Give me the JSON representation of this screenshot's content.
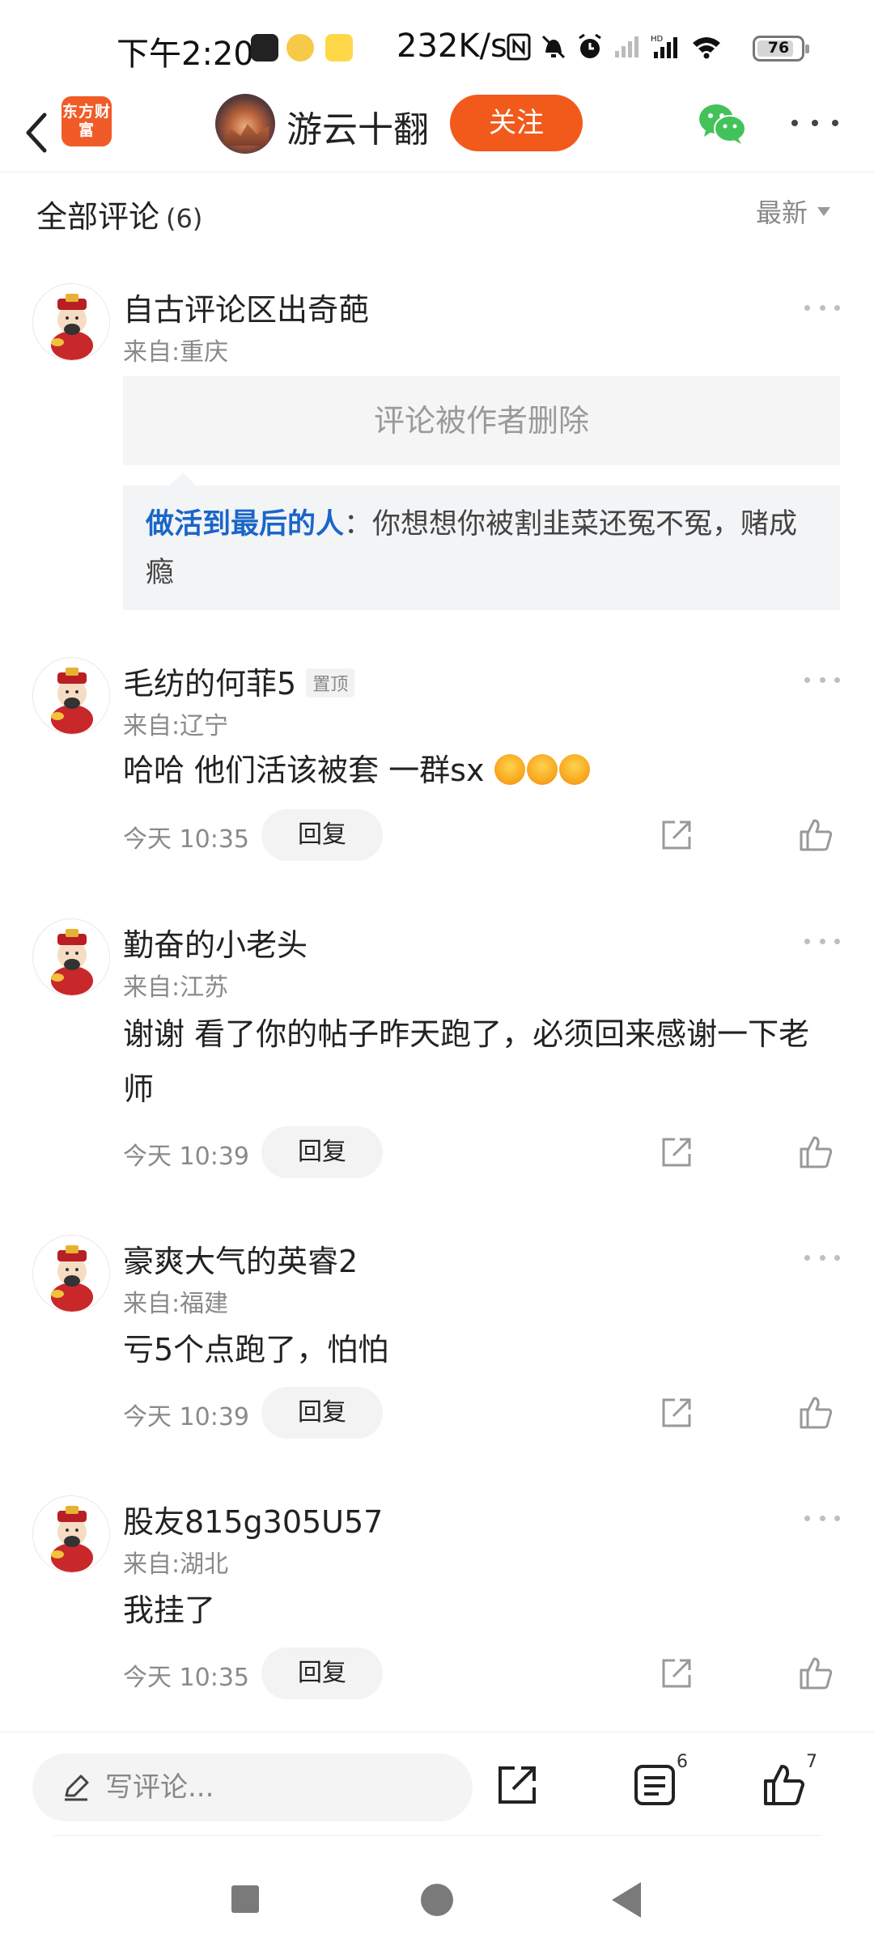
{
  "status_bar": {
    "time": "下午2:20",
    "net_speed": "232K/s",
    "battery": "76",
    "battery_level": 0.76
  },
  "header": {
    "back_icon": "chevron-left-icon",
    "brand_logo_text": "东方财富",
    "author_name": "游云十翻",
    "follow_label": "关注",
    "wechat_icon": "wechat-icon",
    "more_icon": "more-horizontal-icon"
  },
  "comments_header": {
    "title": "全部评论",
    "count": "(6)",
    "sort_label": "最新"
  },
  "comments": [
    {
      "nickname": "自古评论区出奇葩",
      "location": "来自:重庆",
      "deleted_text": "评论被作者删除",
      "quote_author": "做活到最后的人",
      "quote_text": "：你想想你被割韭菜还冤不冤，赌成瘾"
    },
    {
      "nickname": "毛纺的何菲5",
      "pin_tag": "置顶",
      "location": "来自:辽宁",
      "text": "哈哈  他们活该被套 一群sx",
      "emoji_count": 3,
      "time": "今天 10:35",
      "reply_label": "回复"
    },
    {
      "nickname": "勤奋的小老头",
      "location": "来自:江苏",
      "text": "谢谢 看了你的帖子昨天跑了，必须回来感谢一下老师",
      "time": "今天 10:39",
      "reply_label": "回复"
    },
    {
      "nickname": "豪爽大气的英睿2",
      "location": "来自:福建",
      "text": "亏5个点跑了，怕怕",
      "time": "今天 10:39",
      "reply_label": "回复"
    },
    {
      "nickname": "股友815g305U57",
      "location": "来自:湖北",
      "text": "我挂了",
      "time": "今天 10:35",
      "reply_label": "回复"
    }
  ],
  "bottom_bar": {
    "input_placeholder": "写评论...",
    "comments_badge": "6",
    "likes_badge": "7"
  },
  "colors": {
    "accent": "#f25a1b",
    "link_blue": "#1a66c8",
    "brand_red": "#f05b27"
  }
}
